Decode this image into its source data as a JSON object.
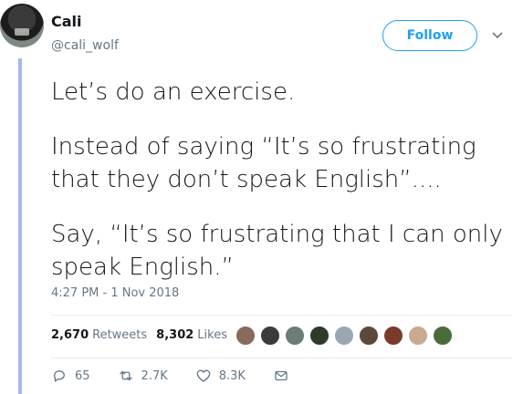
{
  "user": {
    "name": "Cali",
    "handle": "@cali_wolf",
    "follow_label": "Follow"
  },
  "tweet": {
    "paragraphs": [
      "Let’s do an exercise.",
      "Instead of saying “It’s so frustrating that they don’t speak English”....",
      "Say, “It’s so frustrating that I can only speak English.”"
    ],
    "timestamp": "4:27 PM - 1 Nov 2018"
  },
  "stats": {
    "retweets_count": "2,670",
    "retweets_label": "Retweets",
    "likes_count": "8,302",
    "likes_label": "Likes"
  },
  "likers": [
    {
      "color": "#8a6a5a"
    },
    {
      "color": "#3b3b3b"
    },
    {
      "color": "#6b7d74"
    },
    {
      "color": "#2f3a2b"
    },
    {
      "color": "#9aa6b2"
    },
    {
      "color": "#5b4a3a"
    },
    {
      "color": "#7a3b2a"
    },
    {
      "color": "#c9a98f"
    },
    {
      "color": "#4a6b3a"
    }
  ],
  "actions": {
    "reply_count": "65",
    "retweet_count": "2.7K",
    "like_count": "8.3K"
  },
  "colors": {
    "accent": "#1da1f2",
    "thread_line": "#a9b7ee",
    "secondary_text": "#657786"
  }
}
